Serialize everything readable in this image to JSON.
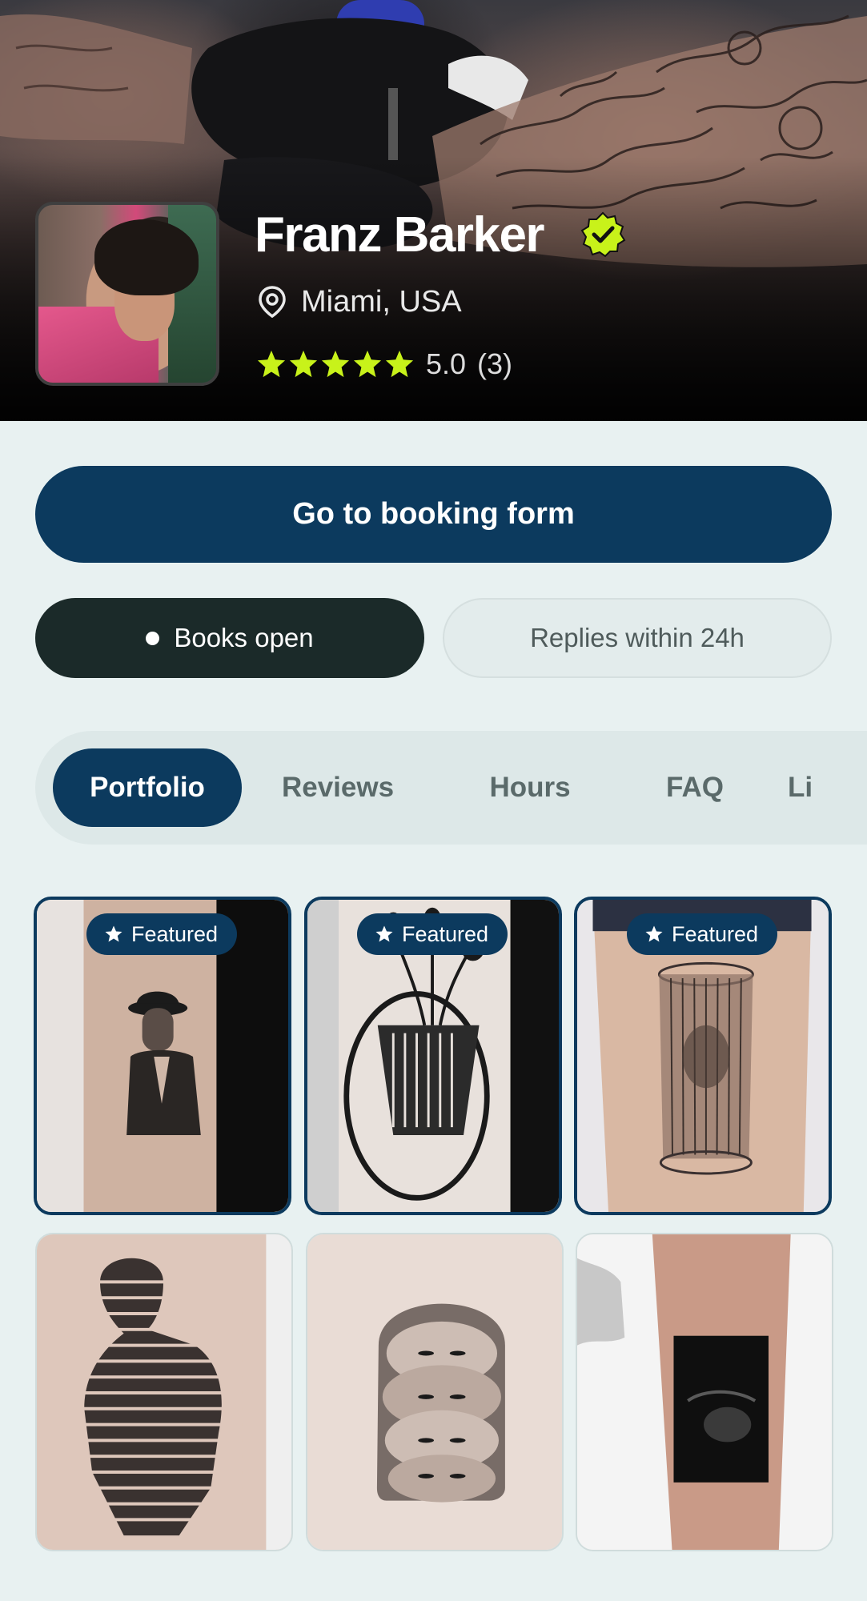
{
  "artist": {
    "name": "Franz Barker",
    "location": "Miami, USA",
    "rating_value": "5.0",
    "review_count": "(3)",
    "stars": 5,
    "verified": true
  },
  "actions": {
    "booking_button": "Go to booking form"
  },
  "status": {
    "books_open": "Books open",
    "reply_time": "Replies within 24h"
  },
  "tabs": [
    {
      "label": "Portfolio",
      "active": true
    },
    {
      "label": "Reviews",
      "active": false
    },
    {
      "label": "Hours",
      "active": false
    },
    {
      "label": "FAQ",
      "active": false
    },
    {
      "label": "Li",
      "active": false
    }
  ],
  "portfolio": {
    "featured_label": "Featured",
    "items": [
      {
        "featured": true,
        "subject": "faceless man in hat"
      },
      {
        "featured": true,
        "subject": "vase with flowers"
      },
      {
        "featured": true,
        "subject": "figure in glass"
      },
      {
        "featured": false,
        "subject": "line-art torso"
      },
      {
        "featured": false,
        "subject": "repeated faces"
      },
      {
        "featured": false,
        "subject": "blurred portrait"
      }
    ]
  },
  "colors": {
    "primary": "#0c3a5e",
    "verified_badge": "#c8f21a",
    "stars": "#c8f21a",
    "background": "#e8f1f1",
    "status_dark": "#1b2a29"
  },
  "icons": {
    "verified": "verified-badge-icon",
    "location": "map-pin-icon",
    "star": "star-icon",
    "featured": "star-icon"
  }
}
